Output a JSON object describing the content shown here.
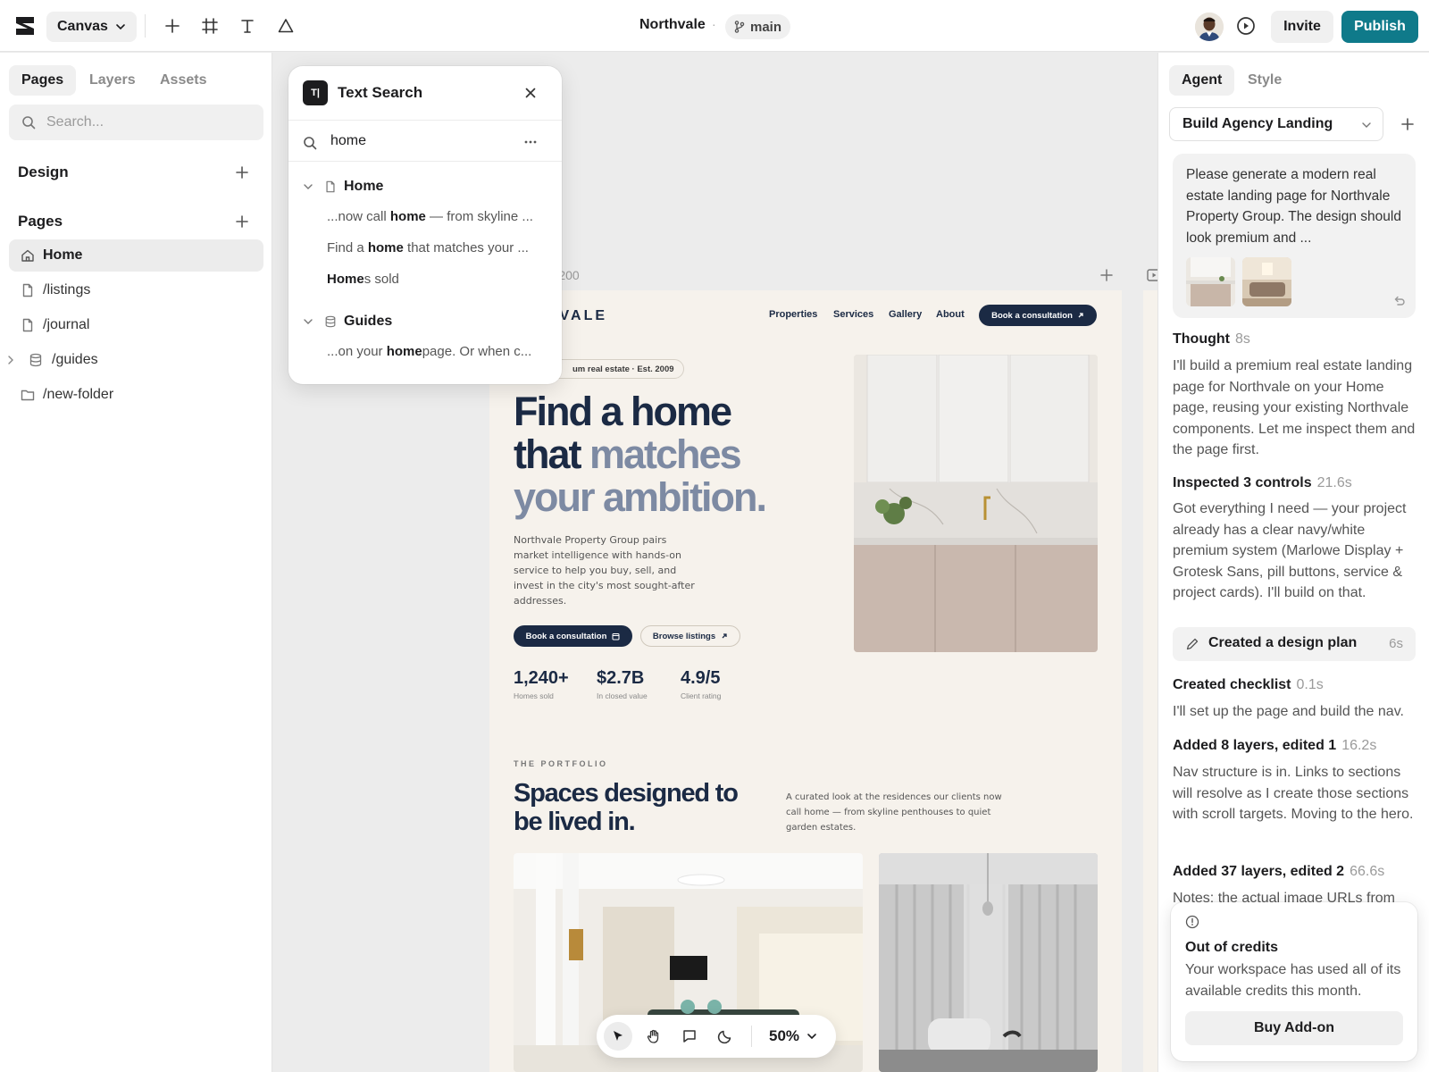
{
  "topbar": {
    "canvas_label": "Canvas",
    "project_name": "Northvale",
    "separator": "·",
    "branch": "main",
    "invite_label": "Invite",
    "publish_label": "Publish",
    "brand_color": "#0f7a8a"
  },
  "left": {
    "tabs": [
      {
        "label": "Pages",
        "active": true
      },
      {
        "label": "Layers",
        "active": false
      },
      {
        "label": "Assets",
        "active": false
      }
    ],
    "search_placeholder": "Search...",
    "design_title": "Design",
    "pages_title": "Pages",
    "pages": [
      {
        "label": "Home",
        "icon": "home-icon",
        "active": true
      },
      {
        "label": "/listings",
        "icon": "file-icon"
      },
      {
        "label": "/journal",
        "icon": "file-icon"
      },
      {
        "label": "/guides",
        "icon": "database-icon",
        "expandable": true
      },
      {
        "label": "/new-folder",
        "icon": "folder-icon"
      }
    ]
  },
  "search_popup": {
    "icon_text": "T|",
    "title": "Text Search",
    "query": "home",
    "groups": [
      {
        "title": "Home",
        "results": [
          {
            "pre": "...now call ",
            "match": "home",
            "post": " — from skyline ..."
          },
          {
            "pre": "Find a ",
            "match": "home",
            "post": " that matches your ..."
          },
          {
            "pre": "",
            "match": "Home",
            "post": "s sold"
          }
        ]
      },
      {
        "title": "Guides",
        "results": [
          {
            "pre": "...on your ",
            "match": "home",
            "post": "page. Or when c..."
          }
        ]
      }
    ]
  },
  "canvas": {
    "frame_label_suffix": "o",
    "frame_width": "1200",
    "site": {
      "brand": "HVALE",
      "nav": [
        "Properties",
        "Services",
        "Gallery",
        "About"
      ],
      "nav_cta": "Book a consultation",
      "est_pill": "um real estate · Est. 2009",
      "hero_line1": "Find a home",
      "hero_line2a": "that ",
      "hero_line2b": "matches",
      "hero_line3": "your ambition.",
      "hero_paragraph": "Northvale Property Group pairs market intelligence with hands-on service to help you buy, sell, and invest in the city's most sought-after addresses.",
      "btn_primary": "Book a consultation",
      "btn_secondary": "Browse listings",
      "stats": [
        {
          "value": "1,240+",
          "label": "Homes sold"
        },
        {
          "value": "$2.7B",
          "label": "In closed value"
        },
        {
          "value": "4.9/5",
          "label": "Client rating"
        }
      ],
      "eyebrow": "THE PORTFOLIO",
      "h2": "Spaces designed to be lived in.",
      "h2_paragraph": "A curated look at the residences our clients now call home — from skyline penthouses to quiet garden estates.",
      "navy": "#1b2a44",
      "accent": "#7d8aa3",
      "cream": "#f6f2ec"
    }
  },
  "toolbar": {
    "zoom": "50%"
  },
  "right": {
    "tabs": [
      {
        "label": "Agent",
        "active": true
      },
      {
        "label": "Style",
        "active": false
      }
    ],
    "agent_name": "Build Agency Landing",
    "prompt": "Please generate a modern real estate landing page for Northvale Property Group. The design should look premium and ...",
    "steps": [
      {
        "title": "Thought",
        "duration": "8s",
        "text": "I'll build a premium real estate landing page for Northvale on your Home page, reusing your existing Northvale components. Let me inspect them and the page first."
      },
      {
        "title": "Inspected 3 controls",
        "duration": "21.6s",
        "text": "Got everything I need — your project already has a clear navy/white premium system (Marlowe Display + Grotesk Sans, pill buttons, service & project cards). I'll build on that."
      },
      {
        "title": "Created a design plan",
        "duration": "6s"
      },
      {
        "title": "Created checklist",
        "duration": "0.1s",
        "text": "I'll set up the page and build the nav."
      },
      {
        "title": "Added 8 layers, edited 1",
        "duration": "16.2s",
        "text": "Nav structure is in. Links to sections will resolve as I create those sections with scroll targets. Moving to the hero."
      },
      {
        "title": "Added 37 layers, edited 2",
        "duration": "66.6s",
        "text": "Notes: the actual image URLs from"
      }
    ],
    "credits": {
      "title": "Out of credits",
      "text": "Your workspace has used all of its available credits this month.",
      "button": "Buy Add-on"
    }
  }
}
